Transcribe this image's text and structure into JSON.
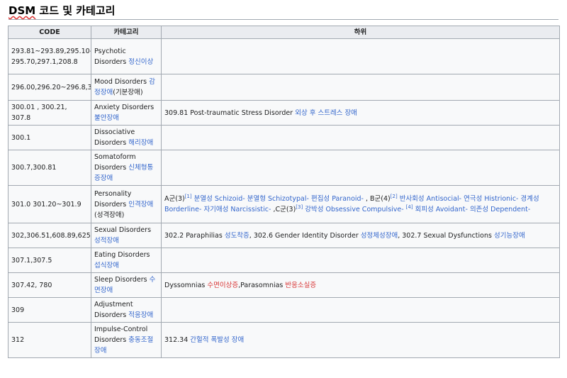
{
  "page": {
    "title_prefix": "DSM",
    "title_rest": " 코드 및 카테고리"
  },
  "table": {
    "headers": [
      "CODE",
      "카테고리",
      "하위"
    ],
    "rows": [
      {
        "code": "293.81~293.89,295.10-295.70,297.1,208.8",
        "category_en": "Psychotic Disorders ",
        "category_ko": "정신이상",
        "category_suffix": "",
        "sub": []
      },
      {
        "code": "296.00,296.20~296.8,311",
        "category_en": "Mood Disorders ",
        "category_ko": "감정장애",
        "category_suffix": "(기분장애)",
        "sub": []
      },
      {
        "code": "300.01 , 300.21, 307.8",
        "category_en": "Anxiety Disorders ",
        "category_ko": "불안장애",
        "category_suffix": "",
        "sub": [
          {
            "text": "309.81 Post-traumatic Stress Disorder ",
            "type": "plain"
          },
          {
            "text": "외상 후 스트레스 장애",
            "type": "link"
          }
        ]
      },
      {
        "code": "300.1",
        "category_en": "Dissociative Disorders ",
        "category_ko": "해리장애",
        "category_suffix": "",
        "sub": []
      },
      {
        "code": "300.7,300.81",
        "category_en": "Somatoform Disorders ",
        "category_ko": "신체형통증장애",
        "category_suffix": "",
        "sub": []
      },
      {
        "code": "301.0 301.20~301.9",
        "category_en": "Personality Disorders ",
        "category_ko": "인격장애",
        "category_suffix": "(성격장애)",
        "sub": [
          {
            "text": "A군(3)",
            "type": "plain"
          },
          {
            "text": "[1]",
            "type": "sup"
          },
          {
            "text": " 분열성 Schizoid- 분열형 Schizotypal- 편집성 Paranoid- ",
            "type": "link"
          },
          {
            "text": ", B군(4)",
            "type": "plain"
          },
          {
            "text": "[2]",
            "type": "sup"
          },
          {
            "text": " 반사회성 Antisocial- 연극성 Histrionic- 경계성 Borderline- 자기애성 Narcissistic- ",
            "type": "link"
          },
          {
            "text": " ,C군(3)",
            "type": "plain"
          },
          {
            "text": "[3]",
            "type": "sup"
          },
          {
            "text": " 강박성 Obsessive Compulsive- ",
            "type": "link"
          },
          {
            "text": "[4]",
            "type": "sup"
          },
          {
            "text": " 회피성 Avoidant- 의존성 Dependent-",
            "type": "link"
          }
        ]
      },
      {
        "code": "302,306.51,608.89,625",
        "category_en": "Sexual Disorders ",
        "category_ko": "성적장애",
        "category_suffix": "",
        "sub": [
          {
            "text": "302.2 Paraphilias ",
            "type": "plain"
          },
          {
            "text": "성도착증",
            "type": "link"
          },
          {
            "text": ", 302.6 Gender Identity Disorder ",
            "type": "plain"
          },
          {
            "text": "성정체성장애",
            "type": "link"
          },
          {
            "text": ", 302.7 Sexual Dysfunctions ",
            "type": "plain"
          },
          {
            "text": "성기능장애",
            "type": "link"
          }
        ]
      },
      {
        "code": "307.1,307.5",
        "category_en": "Eating Disorders ",
        "category_ko": "섭식장애",
        "category_suffix": "",
        "sub": []
      },
      {
        "code": "307.42, 780",
        "category_en": "Sleep Disorders ",
        "category_ko": "수면장애",
        "category_suffix": "",
        "sub": [
          {
            "text": "Dyssomnias ",
            "type": "plain"
          },
          {
            "text": "수면이상증",
            "type": "redlink"
          },
          {
            "text": ",Parasomnias ",
            "type": "plain"
          },
          {
            "text": "반응소실증",
            "type": "redlink"
          }
        ]
      },
      {
        "code": "309",
        "category_en": "Adjustment Disorders ",
        "category_ko": "적응장애",
        "category_suffix": "",
        "sub": []
      },
      {
        "code": "312",
        "category_en": "Impulse-Control Disorders ",
        "category_ko": "충동조절장애",
        "category_suffix": "",
        "sub": [
          {
            "text": "312.34 ",
            "type": "plain"
          },
          {
            "text": "간헐적 폭발성 장애",
            "type": "link"
          }
        ]
      }
    ]
  }
}
